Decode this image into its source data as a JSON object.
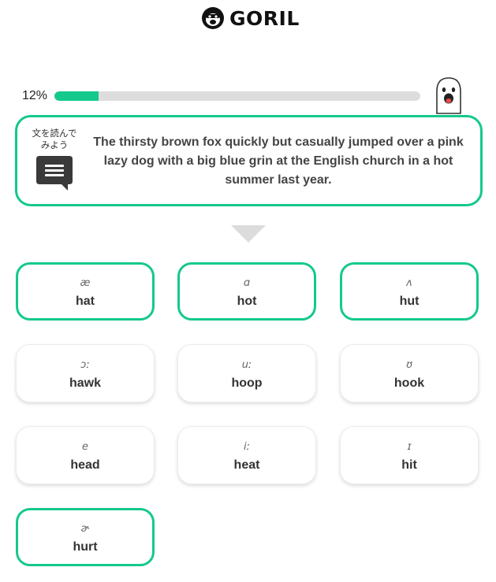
{
  "header": {
    "app_name": "GORIL",
    "logo_icon": "gorilla-icon"
  },
  "progress": {
    "label": "12%",
    "value": 0.12,
    "color": "#14c98b"
  },
  "prompt": {
    "instruction": "文を読んでみよう",
    "icon": "chat-bubble-icon",
    "sentence": "The thirsty brown fox quickly but casually jumped over a pink lazy dog with a big blue grin at the English church in a hot summer last year."
  },
  "options": [
    {
      "ipa": "æ",
      "word": "hat",
      "highlighted": true
    },
    {
      "ipa": "ɑ",
      "word": "hot",
      "highlighted": true
    },
    {
      "ipa": "ʌ",
      "word": "hut",
      "highlighted": true
    },
    {
      "ipa": "ɔː",
      "word": "hawk",
      "highlighted": false
    },
    {
      "ipa": "uː",
      "word": "hoop",
      "highlighted": false
    },
    {
      "ipa": "ʊ",
      "word": "hook",
      "highlighted": false
    },
    {
      "ipa": "e",
      "word": "head",
      "highlighted": false
    },
    {
      "ipa": "iː",
      "word": "heat",
      "highlighted": false
    },
    {
      "ipa": "ɪ",
      "word": "hit",
      "highlighted": false
    },
    {
      "ipa": "ɚ",
      "word": "hurt",
      "highlighted": true
    }
  ],
  "colors": {
    "accent": "#14c98b",
    "track": "#dddddd",
    "arrow": "#dcdcdc"
  }
}
